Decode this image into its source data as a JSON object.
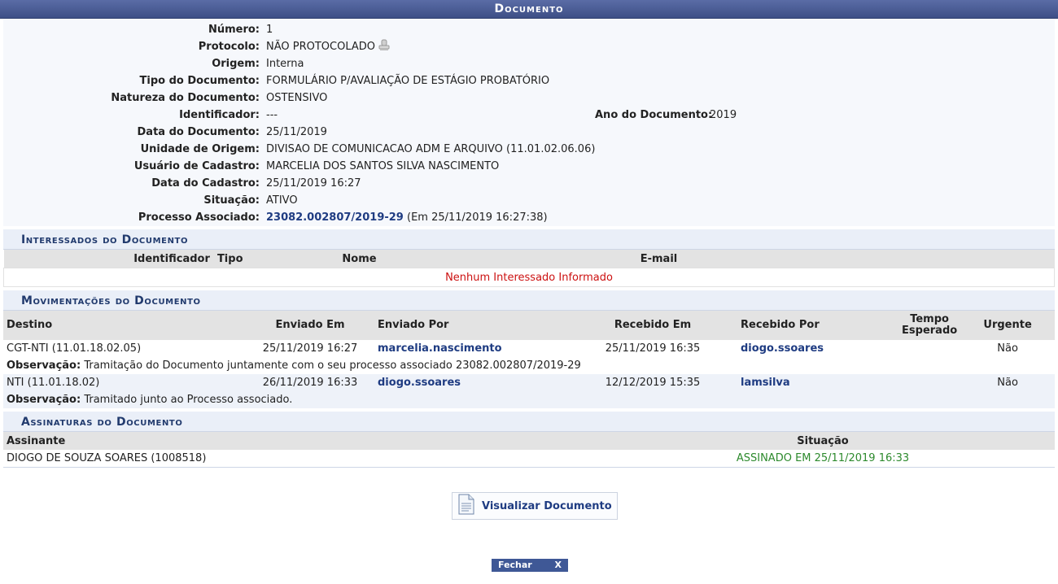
{
  "header": {
    "title": "Documento"
  },
  "doc": {
    "numero_label": "Número:",
    "numero": "1",
    "protocolo_label": "Protocolo:",
    "protocolo": "NÃO PROTOCOLADO",
    "origem_label": "Origem:",
    "origem": "Interna",
    "tipo_label": "Tipo do Documento:",
    "tipo": "FORMULÁRIO P/AVALIAÇÃO DE ESTÁGIO PROBATÓRIO",
    "natureza_label": "Natureza do Documento:",
    "natureza": "OSTENSIVO",
    "identificador_label": "Identificador:",
    "identificador": "---",
    "ano_label": "Ano do Documento:",
    "ano": "2019",
    "data_label": "Data do Documento:",
    "data": "25/11/2019",
    "unidade_label": "Unidade de Origem:",
    "unidade": "DIVISAO DE COMUNICACAO ADM E ARQUIVO (11.01.02.06.06)",
    "usuario_label": "Usuário de Cadastro:",
    "usuario": "MARCELIA DOS SANTOS SILVA NASCIMENTO",
    "data_cad_label": "Data do Cadastro:",
    "data_cad": "25/11/2019 16:27",
    "situacao_label": "Situação:",
    "situacao": "ATIVO",
    "processo_label": "Processo Associado:",
    "processo": "23082.002807/2019-29",
    "processo_em": "(Em 25/11/2019 16:27:38)"
  },
  "interessados": {
    "title": "Interessados do Documento",
    "col_identificador": "Identificador",
    "col_tipo": "Tipo",
    "col_nome": "Nome",
    "col_email": "E-mail",
    "empty": "Nenhum Interessado Informado"
  },
  "movimentacoes": {
    "title": "Movimentações do Documento",
    "cols": {
      "destino": "Destino",
      "enviado_em": "Enviado Em",
      "enviado_por": "Enviado Por",
      "recebido_em": "Recebido Em",
      "recebido_por": "Recebido Por",
      "tempo": "Tempo Esperado",
      "urgente": "Urgente"
    },
    "obs_label": "Observação:",
    "rows": [
      {
        "destino": "CGT-NTI (11.01.18.02.05)",
        "enviado_em": "25/11/2019 16:27",
        "enviado_por": "marcelia.nascimento",
        "recebido_em": "25/11/2019 16:35",
        "recebido_por": "diogo.ssoares",
        "tempo": "",
        "urgente": "Não",
        "obs": "Tramitação do Documento juntamente com o seu processo associado 23082.002807/2019-29"
      },
      {
        "destino": "NTI (11.01.18.02)",
        "enviado_em": "26/11/2019 16:33",
        "enviado_por": "diogo.ssoares",
        "recebido_em": "12/12/2019 15:35",
        "recebido_por": "lamsilva",
        "tempo": "",
        "urgente": "Não",
        "obs": "Tramitado junto ao Processo associado."
      }
    ]
  },
  "assinaturas": {
    "title": "Assinaturas do Documento",
    "col_assinante": "Assinante",
    "col_situacao": "Situação",
    "rows": [
      {
        "assinante": "DIOGO DE SOUZA SOARES (1008518)",
        "situacao": "ASSINADO EM 25/11/2019 16:33"
      }
    ]
  },
  "actions": {
    "visualizar": "Visualizar Documento",
    "fechar": "Fechar",
    "fechar_x": "X"
  },
  "icons": {
    "protocol": "stamp-icon",
    "document": "document-icon",
    "close": "close-icon"
  },
  "colors": {
    "header": "#3e4f86",
    "link": "#1f3c82",
    "error": "#cc1111",
    "success": "#2d8a2d"
  }
}
